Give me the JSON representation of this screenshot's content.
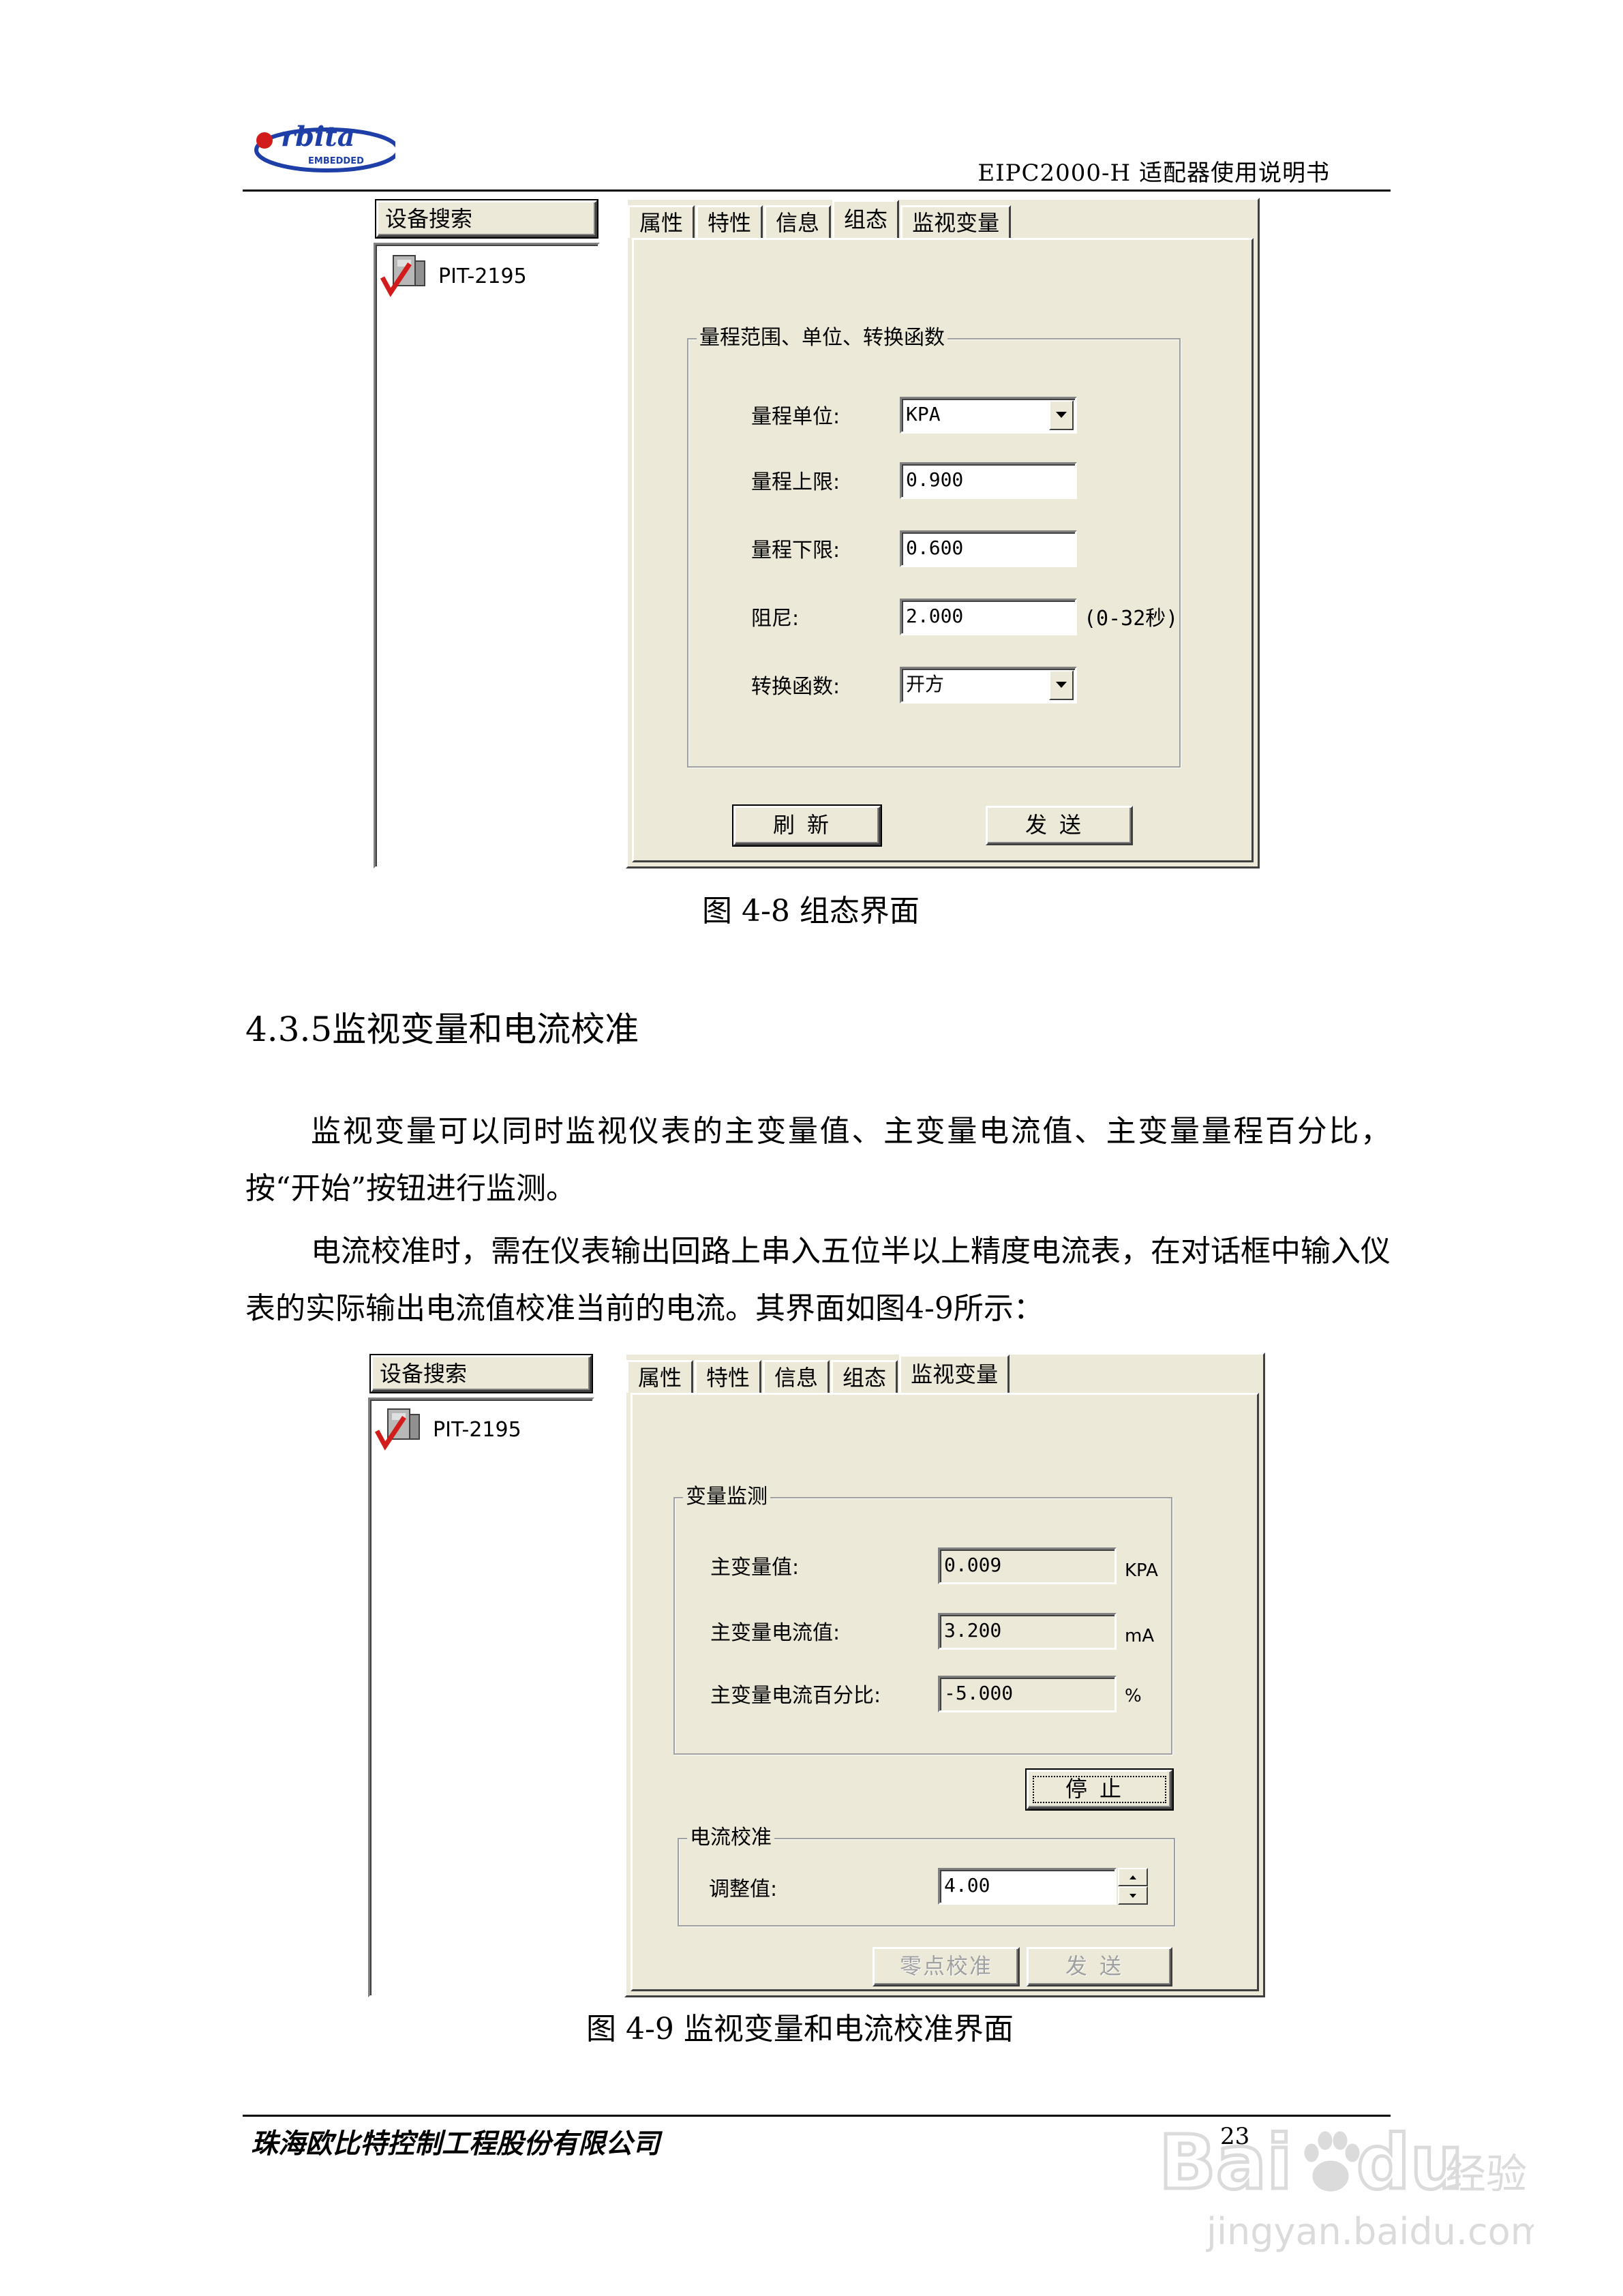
{
  "header": {
    "logo_text": "rbita",
    "logo_subtext": "EMBEDDED",
    "doc_title": "EIPC2000-H 适配器使用说明书"
  },
  "colors": {
    "window_bg": "#ece9d8",
    "logo_blue": "#1e3fa8",
    "logo_red": "#d21c1c"
  },
  "figure1": {
    "tree_button": "设备搜索",
    "tree_item": "PIT-2195",
    "tabs": [
      "属性",
      "特性",
      "信息",
      "组态",
      "监视变量"
    ],
    "active_tab": "组态",
    "group_title": "量程范围、单位、转换函数",
    "unit_label": "量程单位:",
    "unit_value": "KPA",
    "upper_label": "量程上限:",
    "upper_value": "0.900",
    "lower_label": "量程下限:",
    "lower_value": "0.600",
    "damping_label": "阻尼:",
    "damping_value": "2.000",
    "damping_range": "(0-32秒)",
    "function_label": "转换函数:",
    "function_value": "开方",
    "refresh_button": "刷新",
    "send_button": "发送",
    "caption": "图 4-8 组态界面"
  },
  "section": {
    "heading": "4.3.5监视变量和电流校准",
    "paragraph1": "监视变量可以同时监视仪表的主变量值、主变量电流值、主变量量程百分比，按“开始”按钮进行监测。",
    "paragraph2": "电流校准时，需在仪表输出回路上串入五位半以上精度电流表，在对话框中输入仪表的实际输出电流值校准当前的电流。其界面如图4-9所示："
  },
  "figure2": {
    "tree_button": "设备搜索",
    "tree_item": "PIT-2195",
    "tabs": [
      "属性",
      "特性",
      "信息",
      "组态",
      "监视变量"
    ],
    "active_tab": "监视变量",
    "monitor_group": "变量监测",
    "pv_label": "主变量值:",
    "pv_value": "0.009",
    "pv_unit": "KPA",
    "current_label": "主变量电流值:",
    "current_value": "3.200",
    "current_unit": "mA",
    "percent_label": "主变量电流百分比:",
    "percent_value": "-5.000",
    "percent_unit": "%",
    "stop_button": "停止",
    "calib_group": "电流校准",
    "adjust_label": "调整值:",
    "adjust_value": "4.00",
    "zero_button": "零点校准",
    "send_button": "发送",
    "caption": "图 4-9 监视变量和电流校准界面"
  },
  "footer": {
    "company": "珠海欧比特控制工程股份有限公司",
    "page_number": "23",
    "watermark_brand": "Bai",
    "watermark_brand2": "du",
    "watermark_cn": "经验",
    "watermark_url": "jingyan.baidu.com"
  }
}
